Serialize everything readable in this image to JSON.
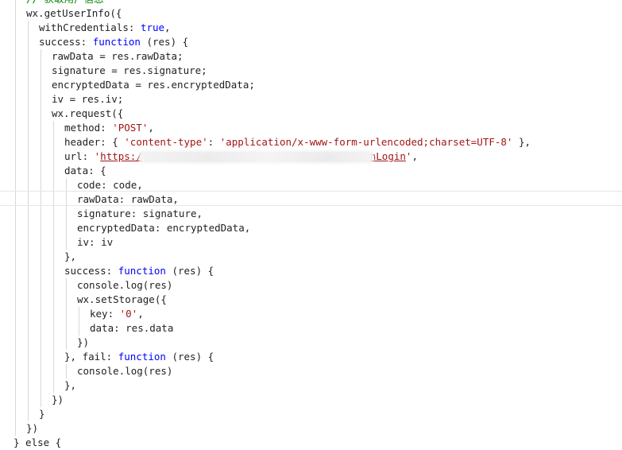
{
  "code": {
    "lines": [
      {
        "indent": 2,
        "tokens": [
          {
            "t": "comment",
            "v": "// 获取用户信息"
          }
        ]
      },
      {
        "indent": 2,
        "tokens": [
          {
            "t": "plain",
            "v": "wx.getUserInfo({"
          }
        ]
      },
      {
        "indent": 3,
        "tokens": [
          {
            "t": "plain",
            "v": "withCredentials: "
          },
          {
            "t": "kw",
            "v": "true"
          },
          {
            "t": "plain",
            "v": ","
          }
        ]
      },
      {
        "indent": 3,
        "tokens": [
          {
            "t": "plain",
            "v": "success: "
          },
          {
            "t": "kw",
            "v": "function"
          },
          {
            "t": "plain",
            "v": " (res) {"
          }
        ]
      },
      {
        "indent": 4,
        "tokens": [
          {
            "t": "plain",
            "v": "rawData = res.rawData;"
          }
        ]
      },
      {
        "indent": 4,
        "tokens": [
          {
            "t": "plain",
            "v": "signature = res.signature;"
          }
        ]
      },
      {
        "indent": 4,
        "tokens": [
          {
            "t": "plain",
            "v": "encryptedData = res.encryptedData;"
          }
        ]
      },
      {
        "indent": 4,
        "tokens": [
          {
            "t": "plain",
            "v": "iv = res.iv;"
          }
        ]
      },
      {
        "indent": 4,
        "tokens": [
          {
            "t": "plain",
            "v": "wx.request({"
          }
        ]
      },
      {
        "indent": 5,
        "tokens": [
          {
            "t": "plain",
            "v": "method: "
          },
          {
            "t": "str",
            "v": "'POST'"
          },
          {
            "t": "plain",
            "v": ","
          }
        ]
      },
      {
        "indent": 5,
        "tokens": [
          {
            "t": "plain",
            "v": "header: { "
          },
          {
            "t": "str",
            "v": "'content-type'"
          },
          {
            "t": "plain",
            "v": ": "
          },
          {
            "t": "str",
            "v": "'application/x-www-form-urlencoded;charset=UTF-8'"
          },
          {
            "t": "plain",
            "v": " },"
          }
        ]
      },
      {
        "indent": 5,
        "tokens": [
          {
            "t": "plain",
            "v": "url: "
          },
          {
            "t": "str",
            "v": "'"
          },
          {
            "t": "url",
            "v": "https:/"
          },
          {
            "t": "gap",
            "v": "",
            "cols": 38
          },
          {
            "t": "url",
            "v": "nLogin"
          },
          {
            "t": "str",
            "v": "'"
          },
          {
            "t": "plain",
            "v": ","
          }
        ]
      },
      {
        "indent": 5,
        "tokens": [
          {
            "t": "plain",
            "v": "data: {"
          }
        ]
      },
      {
        "indent": 6,
        "tokens": [
          {
            "t": "plain",
            "v": "code: code,"
          }
        ]
      },
      {
        "indent": 6,
        "tokens": [
          {
            "t": "plain",
            "v": "rawData: rawData,"
          }
        ]
      },
      {
        "indent": 6,
        "tokens": [
          {
            "t": "plain",
            "v": "signature: signature,"
          }
        ]
      },
      {
        "indent": 6,
        "tokens": [
          {
            "t": "plain",
            "v": "encryptedData: encryptedData,"
          }
        ]
      },
      {
        "indent": 6,
        "tokens": [
          {
            "t": "plain",
            "v": "iv: iv"
          }
        ]
      },
      {
        "indent": 5,
        "tokens": [
          {
            "t": "plain",
            "v": "},"
          }
        ]
      },
      {
        "indent": 5,
        "tokens": [
          {
            "t": "plain",
            "v": "success: "
          },
          {
            "t": "kw",
            "v": "function"
          },
          {
            "t": "plain",
            "v": " (res) {"
          }
        ]
      },
      {
        "indent": 6,
        "tokens": [
          {
            "t": "plain",
            "v": "console.log(res)"
          }
        ]
      },
      {
        "indent": 6,
        "tokens": [
          {
            "t": "plain",
            "v": "wx.setStorage({"
          }
        ]
      },
      {
        "indent": 7,
        "tokens": [
          {
            "t": "plain",
            "v": "key: "
          },
          {
            "t": "str",
            "v": "'0'"
          },
          {
            "t": "plain",
            "v": ","
          }
        ]
      },
      {
        "indent": 7,
        "tokens": [
          {
            "t": "plain",
            "v": "data: res.data"
          }
        ]
      },
      {
        "indent": 6,
        "tokens": [
          {
            "t": "plain",
            "v": "})"
          }
        ]
      },
      {
        "indent": 5,
        "tokens": [
          {
            "t": "plain",
            "v": "}, fail: "
          },
          {
            "t": "kw",
            "v": "function"
          },
          {
            "t": "plain",
            "v": " (res) {"
          }
        ]
      },
      {
        "indent": 6,
        "tokens": [
          {
            "t": "plain",
            "v": "console.log(res)"
          }
        ]
      },
      {
        "indent": 5,
        "tokens": [
          {
            "t": "plain",
            "v": "},"
          }
        ]
      },
      {
        "indent": 4,
        "tokens": [
          {
            "t": "plain",
            "v": "})"
          }
        ]
      },
      {
        "indent": 3,
        "tokens": [
          {
            "t": "plain",
            "v": "}"
          }
        ]
      },
      {
        "indent": 2,
        "tokens": [
          {
            "t": "plain",
            "v": "})"
          }
        ]
      },
      {
        "indent": 1,
        "tokens": [
          {
            "t": "plain",
            "v": "} else {"
          }
        ]
      }
    ]
  },
  "colors": {
    "keyword": "#0000ff",
    "string": "#a31515",
    "comment": "#008000",
    "text": "#1f1f1f",
    "indent_guide": "#d8d8d8"
  }
}
